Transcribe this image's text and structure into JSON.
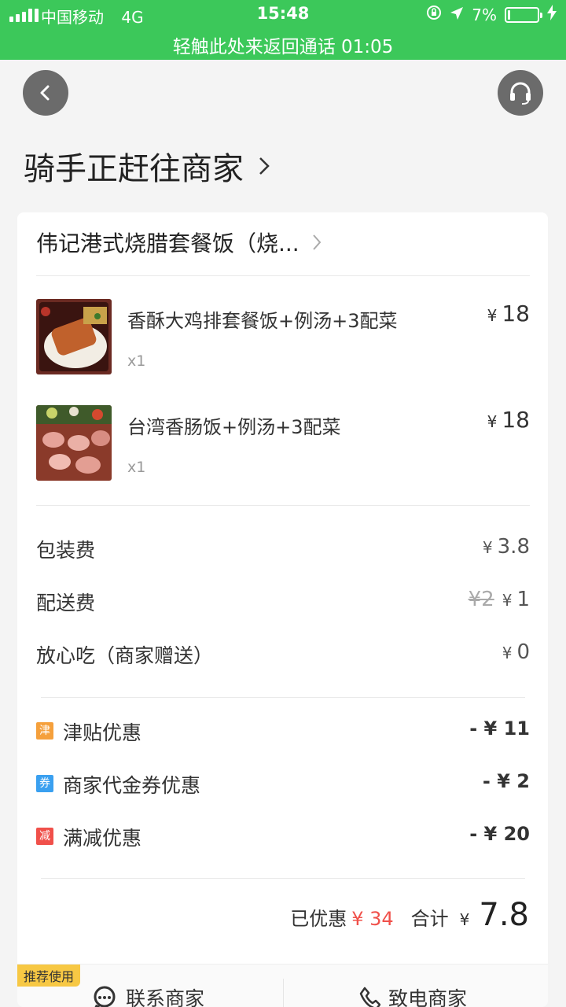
{
  "status": {
    "carrier": "中国移动",
    "network": "4G",
    "time": "15:48",
    "battery_percent": "7%",
    "battery_level": 0.07,
    "call_banner": "轻触此处来返回通话 01:05"
  },
  "header": {
    "back_icon": "chevron-left-icon",
    "support_icon": "headset-icon",
    "title": "骑手正赶往商家"
  },
  "shop": {
    "name": "伟记港式烧腊套餐饭（烧..."
  },
  "items": [
    {
      "name": "香酥大鸡排套餐饭+例汤+3配菜",
      "qty": "x1",
      "currency": "¥",
      "price": "18"
    },
    {
      "name": "台湾香肠饭+例汤+3配菜",
      "qty": "x1",
      "currency": "¥",
      "price": "18"
    }
  ],
  "fees": [
    {
      "label": "包装费",
      "currency": "¥",
      "value": "3.8"
    },
    {
      "label": "配送费",
      "original": "¥2",
      "currency": "¥",
      "value": "1"
    },
    {
      "label": "放心吃（商家赠送）",
      "currency": "¥",
      "value": "0"
    }
  ],
  "discounts": [
    {
      "badge": "津",
      "badge_color": "#f5a03c",
      "label": "津贴优惠",
      "value": "- ¥ 11"
    },
    {
      "badge": "券",
      "badge_color": "#3aa0f0",
      "label": "商家代金券优惠",
      "value": "- ¥ 2"
    },
    {
      "badge": "减",
      "badge_color": "#f0504a",
      "label": "满减优惠",
      "value": "- ¥ 20"
    }
  ],
  "summary": {
    "saved_label": "已优惠",
    "saved_value": "¥ 34",
    "total_label": "合计",
    "currency": "¥",
    "total_value": "7.8"
  },
  "bottom": {
    "recommend_tag": "推荐使用",
    "contact_label": "联系商家",
    "call_label": "致电商家"
  },
  "colors": {
    "statusbar": "#3cc85a",
    "accent_red": "#f0504a"
  }
}
